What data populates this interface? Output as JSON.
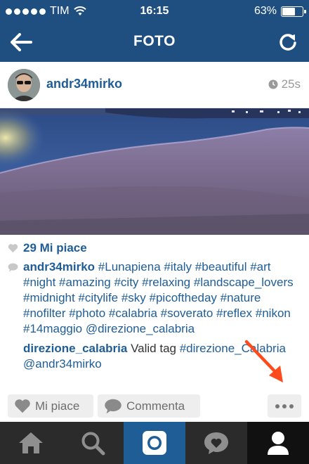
{
  "status_bar": {
    "carrier": "TIM",
    "time": "16:15",
    "battery": "63%",
    "battery_level": 0.63
  },
  "nav": {
    "title": "FOTO"
  },
  "post": {
    "username": "andr34mirko",
    "timestamp": "25s",
    "likes": "29 Mi piace",
    "caption_user": "andr34mirko",
    "caption_text": "#Lunapiena #italy #beautiful #art #night #amazing #city #relaxing #landscape_lovers #midnight #citylife #sky #picoftheday #nature #nofilter #photo #calabria #soverato #reflex #nikon #14maggio @direzione_calabria",
    "comment_user": "direzione_calabria",
    "comment_plain": "Valid tag",
    "comment_tags": "#direzione_Calabria @andr34mirko"
  },
  "actions": {
    "like_label": "Mi piace",
    "comment_label": "Commenta"
  },
  "tabs": [
    {
      "icon": "home-icon"
    },
    {
      "icon": "search-icon"
    },
    {
      "icon": "camera-icon"
    },
    {
      "icon": "activity-heart-icon"
    },
    {
      "icon": "profile-icon"
    }
  ],
  "colors": {
    "header_bg": "#1f4f80",
    "link": "#1f5d96",
    "arrow": "#ff4a1c",
    "tabbar_bg": "#2b2b2b"
  }
}
